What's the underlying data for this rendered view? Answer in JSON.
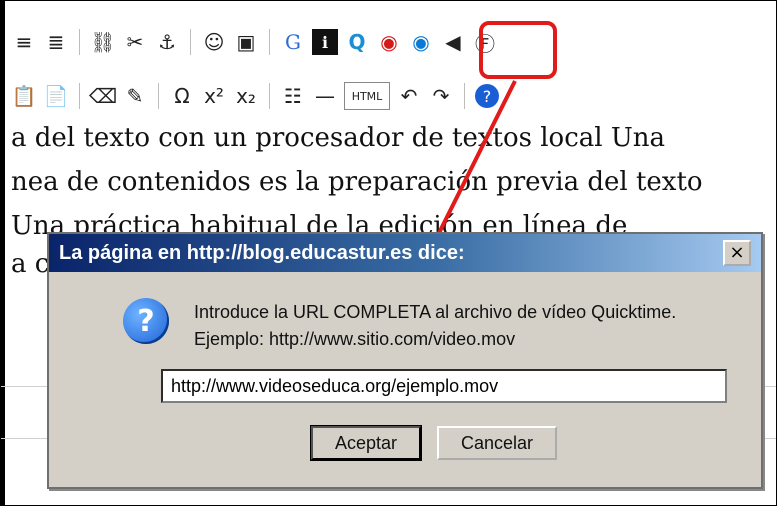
{
  "toolbar_row1": [
    {
      "name": "justify-right-icon",
      "glyph": "≡"
    },
    {
      "name": "justify-full-icon",
      "glyph": "≣"
    },
    {
      "name": "separator"
    },
    {
      "name": "link-icon",
      "glyph": "⛓"
    },
    {
      "name": "unlink-icon",
      "glyph": "✂"
    },
    {
      "name": "anchor-icon",
      "glyph": "⚓"
    },
    {
      "name": "separator"
    },
    {
      "name": "emoticon-icon",
      "glyph": "☺"
    },
    {
      "name": "image-icon",
      "glyph": "▣"
    },
    {
      "name": "separator"
    },
    {
      "name": "google-icon",
      "glyph": "G"
    },
    {
      "name": "info-icon",
      "glyph": "ℹ"
    },
    {
      "name": "quicktime-icon",
      "glyph": "Q"
    },
    {
      "name": "flash-icon",
      "glyph": "◉"
    },
    {
      "name": "media-icon",
      "glyph": "◉"
    },
    {
      "name": "sound-icon",
      "glyph": "◀"
    },
    {
      "name": "flash2-icon",
      "glyph": "Ⓕ"
    }
  ],
  "toolbar_row2": [
    {
      "name": "paste-text-icon",
      "glyph": "📋"
    },
    {
      "name": "paste-word-icon",
      "glyph": "📄"
    },
    {
      "name": "separator"
    },
    {
      "name": "eraser-icon",
      "glyph": "⌫"
    },
    {
      "name": "cleanup-icon",
      "glyph": "✎"
    },
    {
      "name": "separator"
    },
    {
      "name": "omega-icon",
      "glyph": "Ω"
    },
    {
      "name": "superscript-icon",
      "glyph": "x²"
    },
    {
      "name": "subscript-icon",
      "glyph": "x₂"
    },
    {
      "name": "separator"
    },
    {
      "name": "table-icon",
      "glyph": "☷"
    },
    {
      "name": "hr-icon",
      "glyph": "—"
    },
    {
      "name": "html-icon",
      "glyph": "HTML"
    },
    {
      "name": "undo-icon",
      "glyph": "↶"
    },
    {
      "name": "redo-icon",
      "glyph": "↷"
    },
    {
      "name": "separator"
    },
    {
      "name": "help-icon",
      "glyph": "?"
    }
  ],
  "document": {
    "line1": "a del texto con un procesador de textos local Una",
    "line2": "nea de contenidos es la preparación previa del texto",
    "line3": "Una práctica habitual de la edición en línea de",
    "line4": "a c"
  },
  "dialog": {
    "title": "La página en http://blog.educastur.es dice:",
    "close_glyph": "×",
    "message_line1": "Introduce la URL COMPLETA al archivo de vídeo Quicktime.",
    "message_line2": "Ejemplo: http://www.sitio.com/video.mov",
    "input_value": "http://www.videoseduca.org/ejemplo.mov",
    "ok_label": "Aceptar",
    "cancel_label": "Cancelar",
    "icon_glyph": "?"
  },
  "colors": {
    "highlight": "#e11a1a",
    "title_bar": "#0a246a",
    "dialog_bg": "#d4d0c8"
  }
}
